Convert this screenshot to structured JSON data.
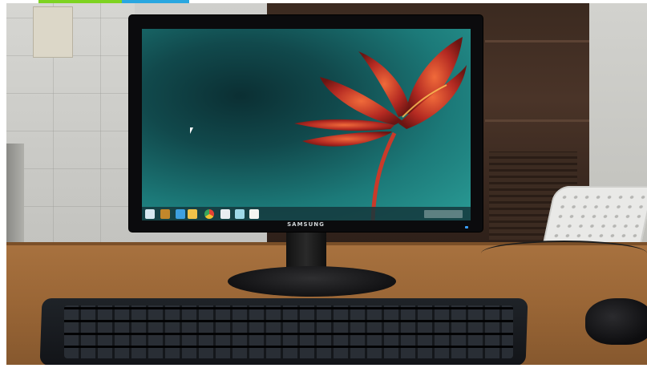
{
  "scene": {
    "description_tags": [
      "wall-tiles",
      "wooden-shelf",
      "chair",
      "desk",
      "monitor",
      "keyboard",
      "mouse"
    ],
    "colors": {
      "desk": "#9a6636",
      "screen_wallpaper": "#1c7a79",
      "flower": "#c93a2a",
      "monitor_bezel": "#0b0b0d",
      "power_led": "#3aa0ff"
    }
  },
  "monitor": {
    "brand": "SAMSUNG"
  },
  "taskbar": {
    "icons": [
      "start-icon",
      "store-icon",
      "ie-icon",
      "folder-icon",
      "chrome-icon",
      "app1-icon",
      "app2-icon",
      "app3-icon"
    ]
  }
}
